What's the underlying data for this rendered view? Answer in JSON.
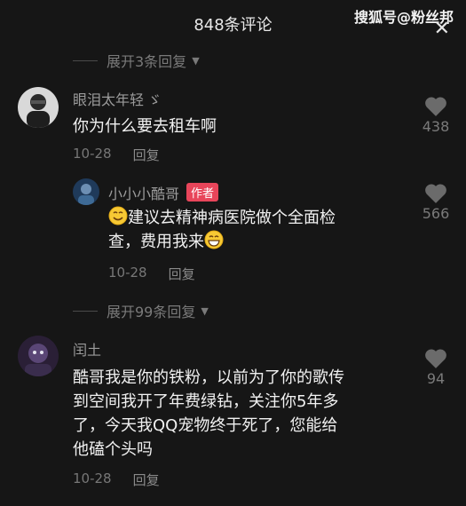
{
  "header": {
    "title": "848条评论",
    "watermark": "搜狐号@粉丝邦",
    "close": "✕"
  },
  "expand_top": {
    "label": "展开3条回复"
  },
  "comment1": {
    "name": "眼泪太年轻",
    "name_suffix": "ゞ",
    "text": "你为什么要去租车啊",
    "date": "10-28",
    "reply": "回复",
    "likes": "438"
  },
  "reply1": {
    "name": "小小小酷哥",
    "badge": "作者",
    "line1": "建议去精神病医院做个全面检",
    "line2": "查，费用我来",
    "date": "10-28",
    "reply": "回复",
    "likes": "566"
  },
  "expand_mid": {
    "label": "展开99条回复"
  },
  "comment2": {
    "name": "闰土",
    "line1": "酷哥我是你的铁粉，以前为了你的歌传",
    "line2": "到空间我开了年费绿钻，关注你5年多",
    "line3": "了，今天我QQ宠物终于死了，您能给",
    "line4": "他磕个头吗",
    "date": "10-28",
    "reply": "回复",
    "likes": "94"
  },
  "icons": [
    "close-icon",
    "chevron-down-icon",
    "heart-icon",
    "smile-emoji",
    "grin-emoji"
  ],
  "colors": {
    "background": "#161616",
    "badge": "#e8455a",
    "muted": "#7a7a7a"
  }
}
